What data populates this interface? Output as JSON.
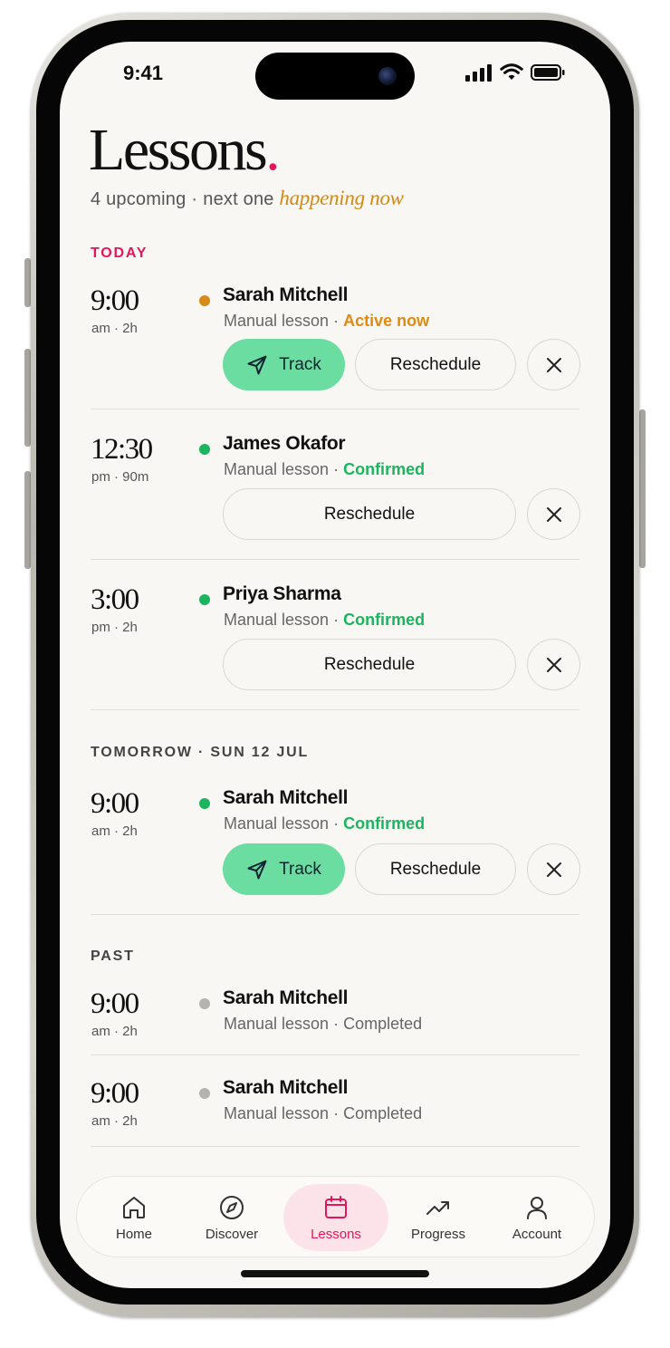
{
  "status_bar": {
    "time": "9:41"
  },
  "header": {
    "title": "Lessons",
    "title_dot": ".",
    "upcoming": "4 upcoming",
    "separator": "·",
    "next_prefix": "next one",
    "next_highlight": "happening now"
  },
  "sections": {
    "today": "TODAY",
    "tomorrow": "TOMORROW · SUN 12 JUL",
    "past": "PAST"
  },
  "lessons": [
    {
      "time": "9:00",
      "meta": "am · 2h",
      "name": "Sarah Mitchell",
      "type": "Manual lesson",
      "sep": " · ",
      "status": "Active now",
      "status_color": "#e08a12",
      "dot_color": "#d68a18"
    },
    {
      "time": "12:30",
      "meta": "pm · 90m",
      "name": "James Okafor",
      "type": "Manual lesson",
      "sep": " · ",
      "status": "Confirmed",
      "status_color": "#1bb55f",
      "dot_color": "#1bb55f"
    },
    {
      "time": "3:00",
      "meta": "pm · 2h",
      "name": "Priya Sharma",
      "type": "Manual lesson",
      "sep": " · ",
      "status": "Confirmed",
      "status_color": "#1bb55f",
      "dot_color": "#1bb55f"
    },
    {
      "time": "9:00",
      "meta": "am · 2h",
      "name": "Sarah Mitchell",
      "type": "Manual lesson",
      "sep": " · ",
      "status": "Confirmed",
      "status_color": "#1bb55f",
      "dot_color": "#1bb55f"
    },
    {
      "time": "9:00",
      "meta": "am · 2h",
      "name": "Sarah Mitchell",
      "type": "Manual lesson",
      "sep": " · ",
      "status": "Completed",
      "status_color": "#666666",
      "dot_color": "#b5b3ae"
    },
    {
      "time": "9:00",
      "meta": "am · 2h",
      "name": "Sarah Mitchell",
      "type": "Manual lesson",
      "sep": " · ",
      "status": "Completed",
      "status_color": "#666666",
      "dot_color": "#b5b3ae"
    }
  ],
  "buttons": {
    "track": "Track",
    "reschedule": "Reschedule",
    "cancel_icon": "close-icon"
  },
  "tabbar": {
    "items": [
      {
        "label": "Home",
        "icon": "home-icon"
      },
      {
        "label": "Discover",
        "icon": "compass-icon"
      },
      {
        "label": "Lessons",
        "icon": "calendar-icon"
      },
      {
        "label": "Progress",
        "icon": "trending-up-icon"
      },
      {
        "label": "Account",
        "icon": "person-icon"
      }
    ],
    "active": "Lessons"
  },
  "colors": {
    "accent": "#e3165b",
    "track_green": "#6bdda0",
    "active_orange": "#e08a12",
    "confirmed_green": "#1bb55f"
  }
}
